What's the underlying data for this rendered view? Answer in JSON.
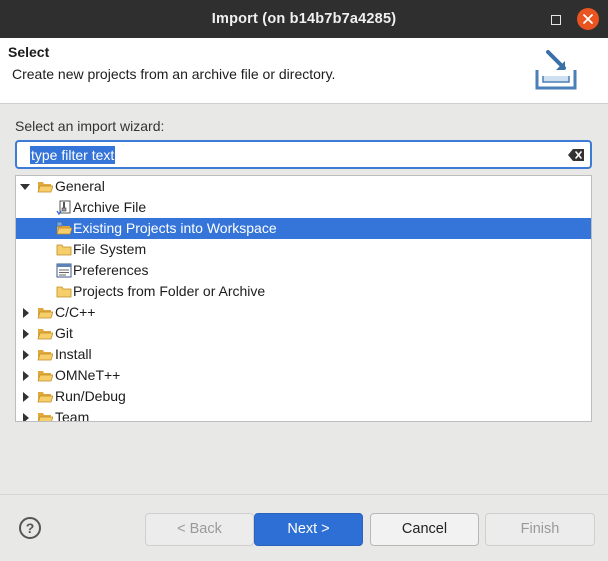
{
  "window": {
    "title": "Import  (on b14b7b7a4285)"
  },
  "header": {
    "title": "Select",
    "description": "Create new projects from an archive file or directory."
  },
  "wizard_label": "Select an import wizard:",
  "filter": {
    "value": "type filter text"
  },
  "tree": [
    {
      "label": "General",
      "expanded": true,
      "icon": "folder-open-icon"
    },
    {
      "label": "Archive File",
      "icon": "archive-file-icon"
    },
    {
      "label": "Existing Projects into Workspace",
      "icon": "project-folder-icon",
      "selected": true
    },
    {
      "label": "File System",
      "icon": "folder-icon"
    },
    {
      "label": "Preferences",
      "icon": "preferences-icon"
    },
    {
      "label": "Projects from Folder or Archive",
      "icon": "folder-icon"
    },
    {
      "label": "C/C++",
      "expanded": false,
      "icon": "folder-icon"
    },
    {
      "label": "Git",
      "expanded": false,
      "icon": "folder-icon"
    },
    {
      "label": "Install",
      "expanded": false,
      "icon": "folder-icon"
    },
    {
      "label": "OMNeT++",
      "expanded": false,
      "icon": "folder-icon"
    },
    {
      "label": "Run/Debug",
      "expanded": false,
      "icon": "folder-icon"
    },
    {
      "label": "Team",
      "expanded": false,
      "icon": "folder-icon"
    }
  ],
  "buttons": {
    "help": "?",
    "back": "< Back",
    "next": "Next >",
    "cancel": "Cancel",
    "finish": "Finish"
  },
  "colors": {
    "accent": "#3574d8",
    "close_button": "#e95420",
    "titlebar": "#2f2f2f"
  }
}
